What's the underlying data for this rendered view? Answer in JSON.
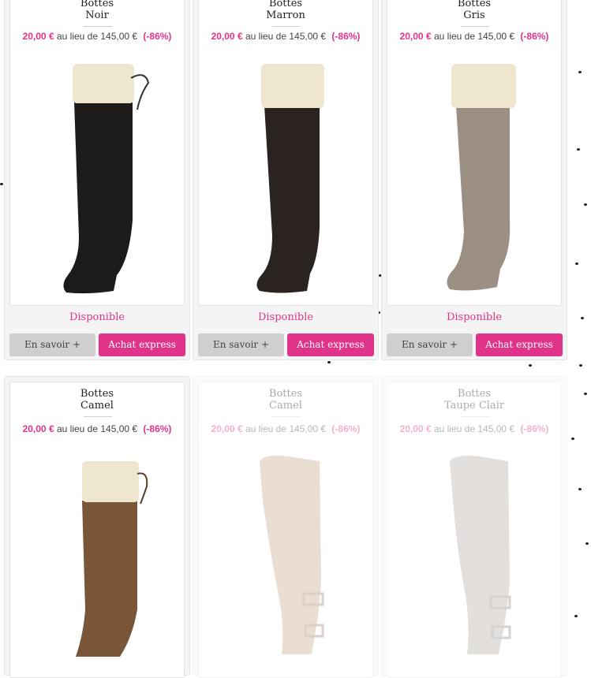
{
  "colors": {
    "accent": "#e0338a",
    "secondary_button": "#cfcfcf"
  },
  "products": [
    {
      "title": "Bottes",
      "variant": "Noir",
      "price_now": "20,00 €",
      "price_text": "au lieu de 145,00 €",
      "discount": "(-86%)",
      "availability": "Disponible",
      "more_label": "En savoir +",
      "buy_label": "Achat express",
      "boot_color": "#1e1c1b"
    },
    {
      "title": "Bottes",
      "variant": "Marron",
      "price_now": "20,00 €",
      "price_text": "au lieu de 145,00 €",
      "discount": "(-86%)",
      "availability": "Disponible",
      "more_label": "En savoir +",
      "buy_label": "Achat express",
      "boot_color": "#2b2320"
    },
    {
      "title": "Bottes",
      "variant": "Gris",
      "price_now": "20,00 €",
      "price_text": "au lieu de 145,00 €",
      "discount": "(-86%)",
      "availability": "Disponible",
      "more_label": "En savoir +",
      "buy_label": "Achat express",
      "boot_color": "#9a8f82"
    },
    {
      "title": "Bottes",
      "variant": "Camel",
      "price_now": "20,00 €",
      "price_text": "au lieu de 145,00 €",
      "discount": "(-86%)",
      "boot_color": "#7a5639"
    },
    {
      "title": "Bottes",
      "variant": "Camel",
      "price_now": "20,00 €",
      "price_text": "au lieu de 145,00 €",
      "discount": "(-86%)",
      "boot_color": "#c9a98e"
    },
    {
      "title": "Bottes",
      "variant": "Taupe Clair",
      "price_now": "20,00 €",
      "price_text": "au lieu de 145,00 €",
      "discount": "(-86%)",
      "boot_color": "#b5aea4"
    }
  ]
}
